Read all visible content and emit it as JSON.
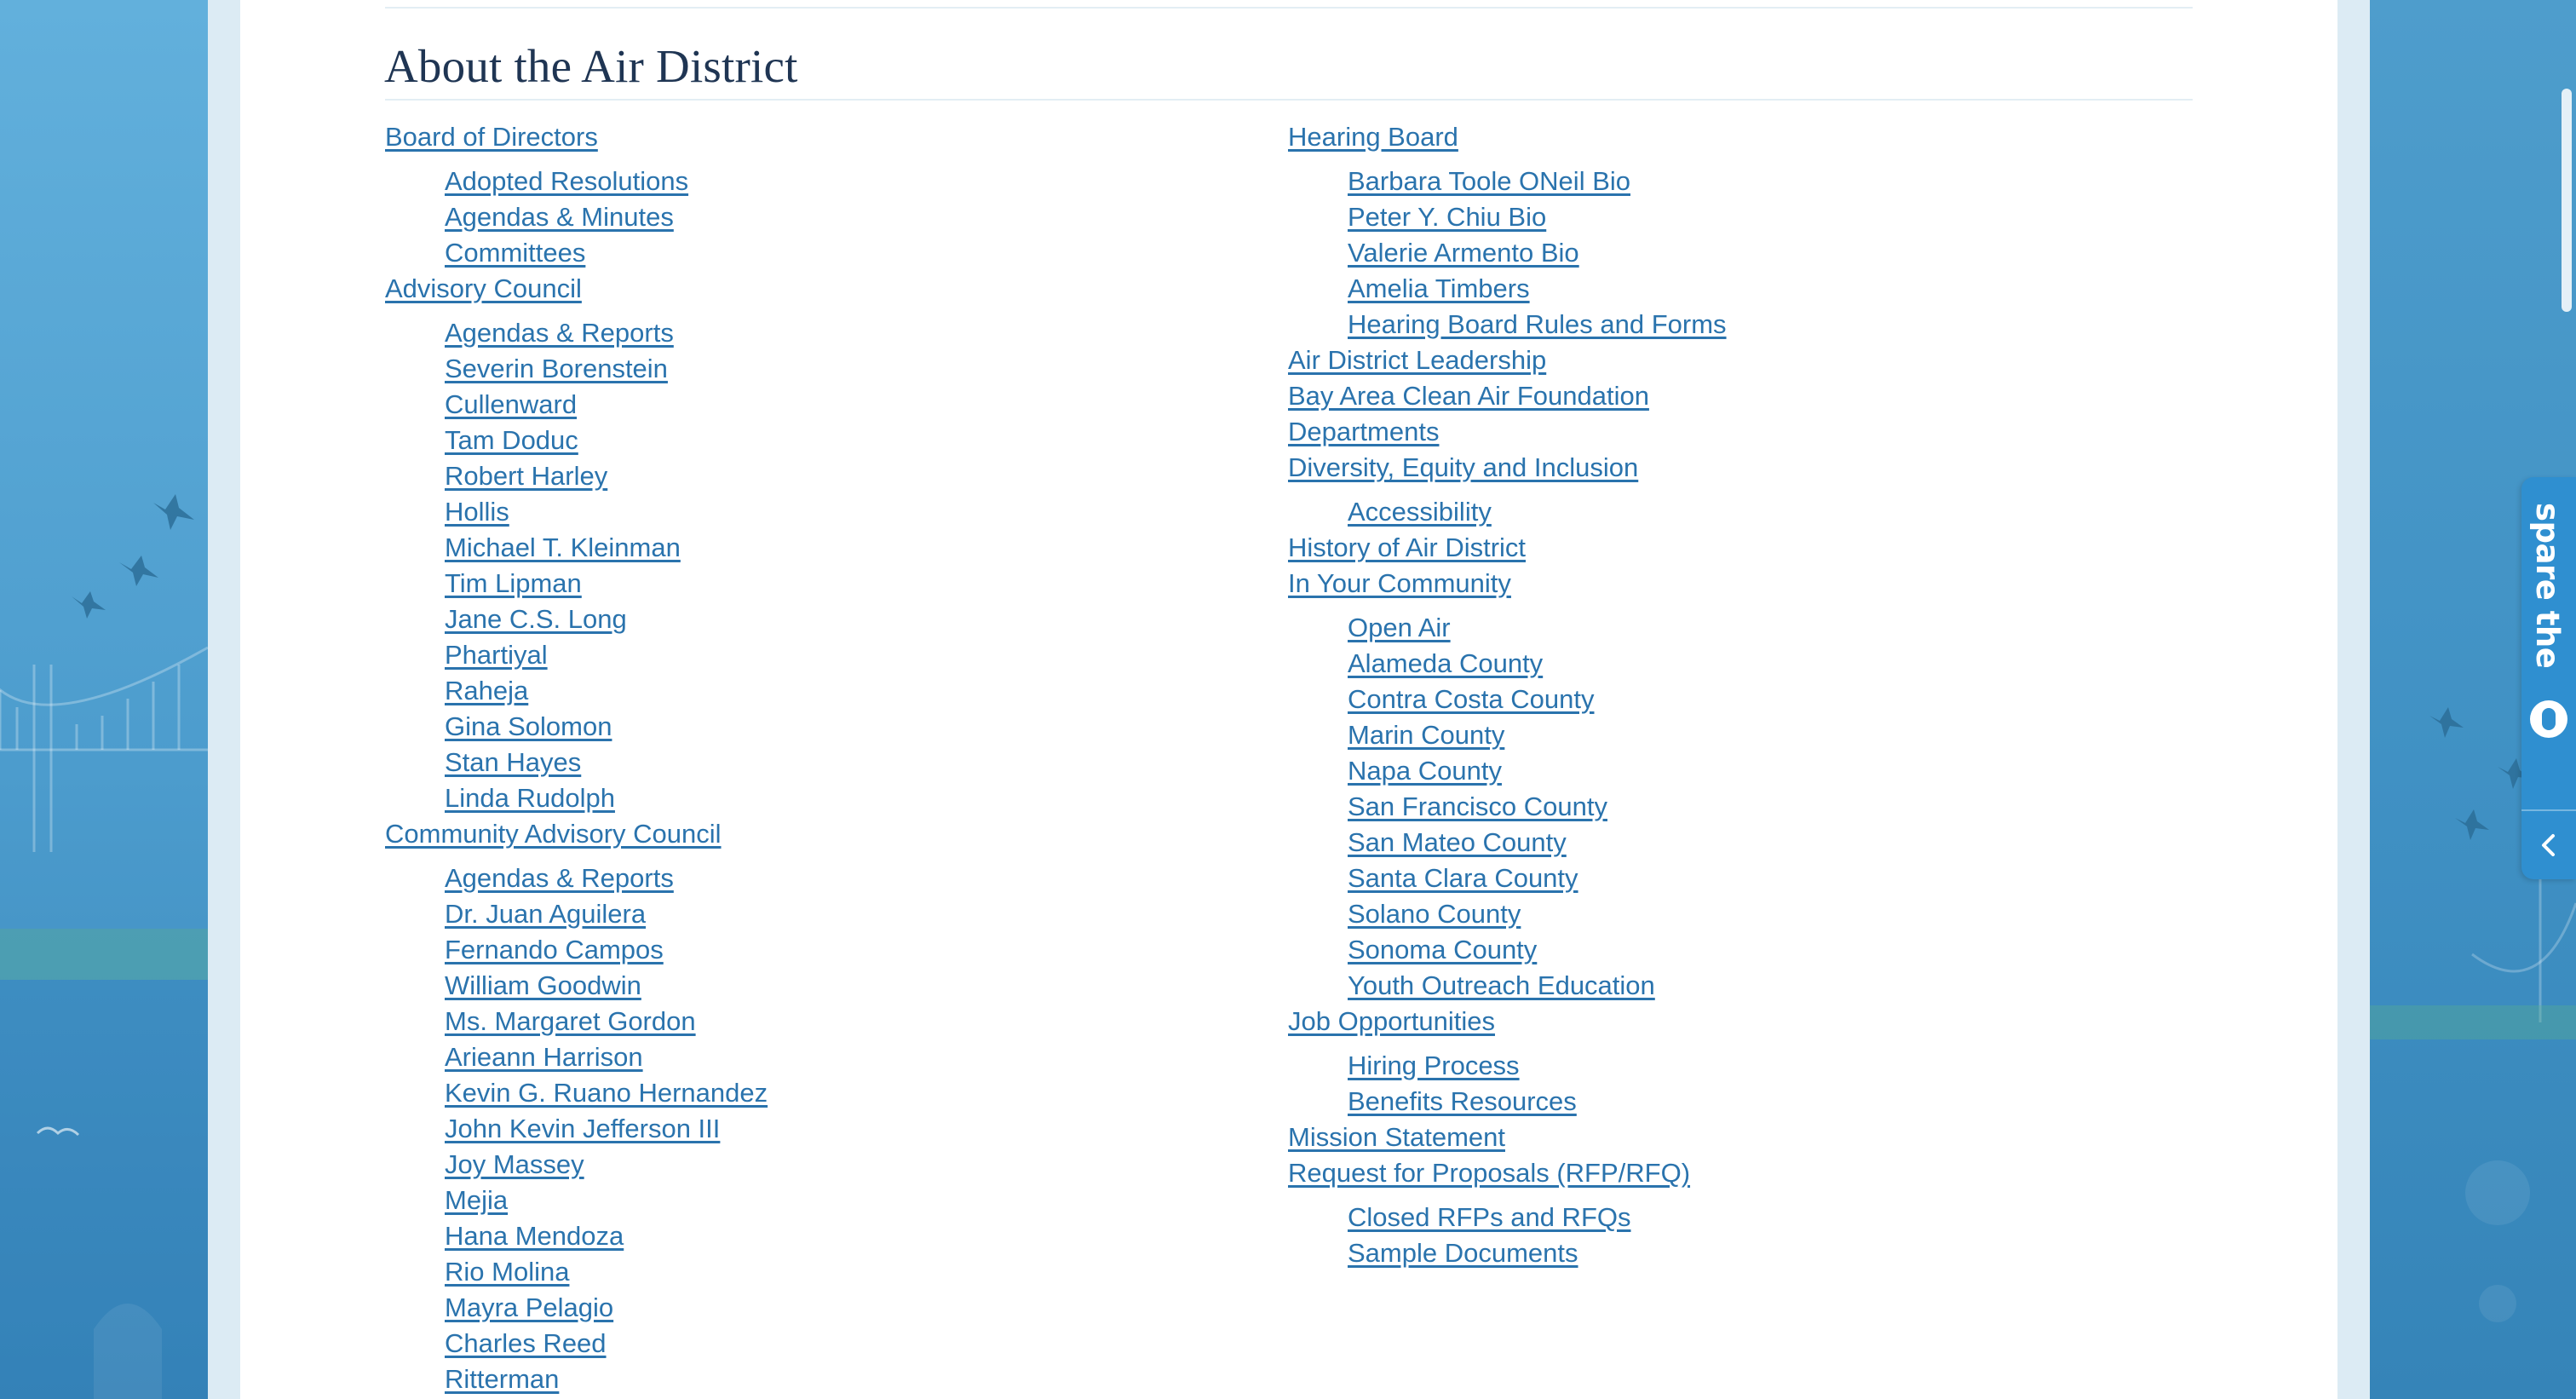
{
  "page": {
    "heading": "About the Air District"
  },
  "links": {
    "left_column": [
      {
        "label": "Board of Directors",
        "children": [
          "Adopted Resolutions",
          "Agendas & Minutes",
          "Committees"
        ]
      },
      {
        "label": "Advisory Council",
        "children": [
          "Agendas & Reports",
          "Severin Borenstein",
          "Cullenward",
          "Tam Doduc",
          "Robert Harley",
          "Hollis",
          "Michael T. Kleinman",
          "Tim Lipman",
          "Jane C.S. Long",
          "Phartiyal",
          "Raheja",
          "Gina Solomon",
          "Stan Hayes",
          "Linda Rudolph"
        ]
      },
      {
        "label": "Community Advisory Council",
        "children": [
          "Agendas & Reports",
          "Dr. Juan Aguilera",
          "Fernando Campos",
          "William Goodwin",
          "Ms. Margaret Gordon",
          "Arieann Harrison",
          "Kevin G. Ruano Hernandez",
          "John Kevin Jefferson III",
          "Joy Massey",
          "Mejia",
          "Hana Mendoza",
          "Rio Molina",
          "Mayra Pelagio",
          "Charles Reed",
          "Ritterman"
        ]
      }
    ],
    "right_column": [
      {
        "label": "Hearing Board",
        "children": [
          "Barbara Toole ONeil Bio",
          "Peter Y. Chiu Bio",
          "Valerie Armento Bio",
          "Amelia Timbers",
          "Hearing Board Rules and Forms"
        ]
      },
      {
        "label": "Air District Leadership",
        "children": []
      },
      {
        "label": "Bay Area Clean Air Foundation",
        "children": []
      },
      {
        "label": "Departments",
        "children": []
      },
      {
        "label": "Diversity, Equity and Inclusion",
        "children": [
          "Accessibility"
        ]
      },
      {
        "label": "History of Air District",
        "children": []
      },
      {
        "label": "In Your Community",
        "children": [
          "Open Air",
          "Alameda County",
          "Contra Costa County",
          "Marin County",
          "Napa County",
          "San Francisco County",
          "San Mateo County",
          "Santa Clara County",
          "Solano County",
          "Sonoma County",
          "Youth Outreach Education"
        ]
      },
      {
        "label": "Job Opportunities",
        "children": [
          "Hiring Process",
          "Benefits Resources"
        ]
      },
      {
        "label": "Mission Statement",
        "children": []
      },
      {
        "label": "Request for Proposals (RFP/RFQ)",
        "children": [
          "Closed RFPs and RFQs",
          "Sample Documents"
        ]
      }
    ]
  },
  "spare_the_air": {
    "label": "spare the",
    "logo_icon": "spare-the-air-logo-icon",
    "toggle_icon": "chevron-left-icon"
  },
  "colors": {
    "link": "#2a73ad",
    "heading": "#1f3553",
    "background": "#4a9bcc",
    "tab": "#2f8fd0"
  }
}
